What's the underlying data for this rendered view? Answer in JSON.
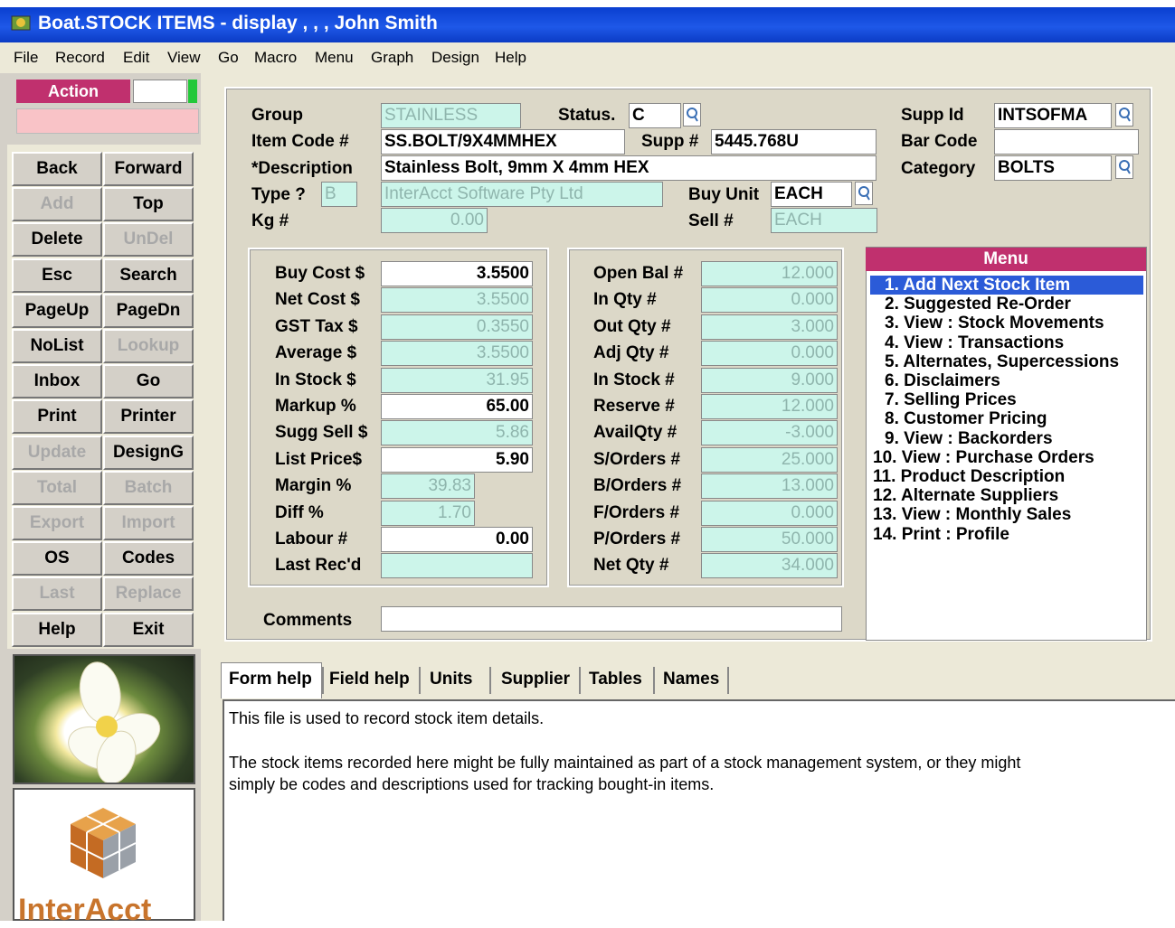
{
  "window": {
    "title": "Boat.STOCK ITEMS - display , , , John Smith"
  },
  "menubar": [
    "File",
    "Record",
    "Edit",
    "View",
    "Go",
    "Macro",
    "Menu",
    "Graph",
    "Design",
    "Help"
  ],
  "action": {
    "label": "Action"
  },
  "buttons": [
    {
      "label": "Back",
      "enabled": true
    },
    {
      "label": "Forward",
      "enabled": true
    },
    {
      "label": "Add",
      "enabled": false
    },
    {
      "label": "Top",
      "enabled": true
    },
    {
      "label": "Delete",
      "enabled": true
    },
    {
      "label": "UnDel",
      "enabled": false
    },
    {
      "label": "Esc",
      "enabled": true
    },
    {
      "label": "Search",
      "enabled": true
    },
    {
      "label": "PageUp",
      "enabled": true
    },
    {
      "label": "PageDn",
      "enabled": true
    },
    {
      "label": "NoList",
      "enabled": true
    },
    {
      "label": "Lookup",
      "enabled": false
    },
    {
      "label": "Inbox",
      "enabled": true
    },
    {
      "label": "Go",
      "enabled": true
    },
    {
      "label": "Print",
      "enabled": true
    },
    {
      "label": "Printer",
      "enabled": true
    },
    {
      "label": "Update",
      "enabled": false
    },
    {
      "label": "DesignG",
      "enabled": true
    },
    {
      "label": "Total",
      "enabled": false
    },
    {
      "label": "Batch",
      "enabled": false
    },
    {
      "label": "Export",
      "enabled": false
    },
    {
      "label": "Import",
      "enabled": false
    },
    {
      "label": "OS",
      "enabled": true
    },
    {
      "label": "Codes",
      "enabled": true
    },
    {
      "label": "Last",
      "enabled": false
    },
    {
      "label": "Replace",
      "enabled": false
    },
    {
      "label": "Help",
      "enabled": true
    },
    {
      "label": "Exit",
      "enabled": true
    }
  ],
  "logo": {
    "text": "InterAcct"
  },
  "form": {
    "group": {
      "label": "Group",
      "value": "STAINLESS"
    },
    "status": {
      "label": "Status.",
      "value": "C"
    },
    "supp_id": {
      "label": "Supp Id",
      "value": "INTSOFMA"
    },
    "item_code": {
      "label": "Item Code #",
      "value": "SS.BOLT/9X4MMHEX"
    },
    "supp_no": {
      "label": "Supp #",
      "value": "5445.768U"
    },
    "bar_code": {
      "label": "Bar Code",
      "value": ""
    },
    "description": {
      "label": "*Description",
      "value": "Stainless Bolt, 9mm X 4mm HEX"
    },
    "category": {
      "label": "Category",
      "value": "BOLTS"
    },
    "type": {
      "label": "Type ?",
      "value": "B",
      "name": "InterAcct Software Pty Ltd"
    },
    "buy_unit": {
      "label": "Buy Unit",
      "value": "EACH"
    },
    "kg": {
      "label": "Kg #",
      "value": "0.00"
    },
    "sell": {
      "label": "Sell #",
      "value": "EACH"
    },
    "costs": [
      {
        "label": "Buy Cost $",
        "value": "3.5500",
        "editable": true
      },
      {
        "label": "Net Cost  $",
        "value": "3.5500",
        "editable": false
      },
      {
        "label": "GST Tax  $",
        "value": "0.3550",
        "editable": false
      },
      {
        "label": "Average  $",
        "value": "3.5500",
        "editable": false
      },
      {
        "label": "In Stock  $",
        "value": "31.95",
        "editable": false
      },
      {
        "label": "Markup %",
        "value": "65.00",
        "editable": true
      },
      {
        "label": "Sugg Sell $",
        "value": "5.86",
        "editable": false
      },
      {
        "label": "List Price$",
        "value": "5.90",
        "editable": true
      },
      {
        "label": "Margin %",
        "value": "39.83",
        "editable": false
      },
      {
        "label": "Diff %",
        "value": "1.70",
        "editable": false
      },
      {
        "label": "Labour #",
        "value": "0.00",
        "editable": true
      },
      {
        "label": "Last Rec'd",
        "value": "",
        "editable": false
      }
    ],
    "qty": [
      {
        "label": "Open Bal #",
        "value": "12.000"
      },
      {
        "label": "In  Qty  #",
        "value": "0.000"
      },
      {
        "label": "Out Qty  #",
        "value": "3.000"
      },
      {
        "label": "Adj Qty  #",
        "value": "0.000"
      },
      {
        "label": "In Stock #",
        "value": "9.000"
      },
      {
        "label": "Reserve  #",
        "value": "12.000"
      },
      {
        "label": "AvailQty #",
        "value": "-3.000"
      },
      {
        "label": "S/Orders #",
        "value": "25.000"
      },
      {
        "label": "B/Orders #",
        "value": "13.000"
      },
      {
        "label": "F/Orders #",
        "value": "0.000"
      },
      {
        "label": "P/Orders #",
        "value": "50.000"
      },
      {
        "label": "Net Qty  #",
        "value": "34.000"
      }
    ],
    "comments": {
      "label": "Comments",
      "value": ""
    }
  },
  "menu": {
    "title": "Menu",
    "items": [
      "1. Add Next Stock Item",
      "2. Suggested Re-Order",
      "3. View : Stock Movements",
      "4. View : Transactions",
      "5. Alternates, Supercessions",
      "6. Disclaimers",
      "7. Selling Prices",
      "8. Customer Pricing",
      "9. View : Backorders",
      "10. View : Purchase Orders",
      "11. Product Description",
      "12. Alternate Suppliers",
      "13. View : Monthly Sales",
      "14. Print : Profile"
    ],
    "selected_index": 0
  },
  "tabs": [
    "Form help",
    "Field help",
    "Units",
    "Supplier",
    "Tables",
    "Names"
  ],
  "help": {
    "line1": "This file is used to record stock item details.",
    "line2": "The stock items recorded here might be fully maintained as part of a stock management system, or they might",
    "line3": "simply be codes and descriptions used for tracking bought-in items."
  },
  "colors": {
    "accent": "#c0306e",
    "title_blue": "#0a3fd0",
    "readonly_bg": "#ccf5ea",
    "selected_blue": "#2b5bd8"
  }
}
